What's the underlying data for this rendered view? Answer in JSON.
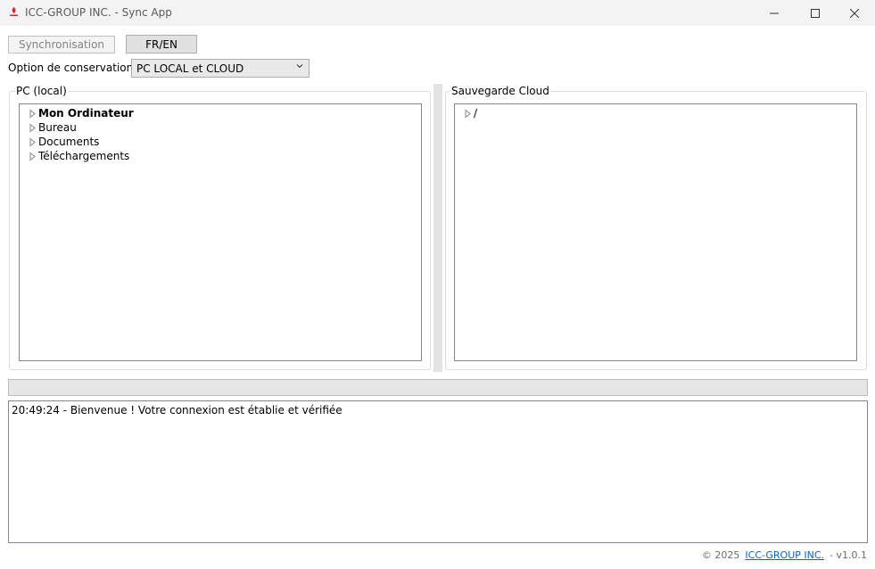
{
  "window": {
    "title": "ICC-GROUP INC. - Sync App",
    "app_icon": "icc-logo-icon",
    "accent_color": "#d9262c"
  },
  "toolbar": {
    "sync_label": "Synchronisation",
    "lang_label": "FR/EN"
  },
  "options": {
    "label": "Option de conservation :",
    "selected": "PC LOCAL et CLOUD"
  },
  "local_panel": {
    "title": "PC (local)",
    "items": [
      {
        "label": "Mon Ordinateur"
      },
      {
        "label": "Bureau"
      },
      {
        "label": "Documents"
      },
      {
        "label": "Téléchargements"
      }
    ]
  },
  "cloud_panel": {
    "title": "Sauvegarde Cloud",
    "items": [
      {
        "label": "/"
      }
    ]
  },
  "progress": {
    "value": 0
  },
  "log": {
    "lines": [
      "20:49:24 - Bienvenue ! Votre connexion est établie et vérifiée"
    ]
  },
  "footer": {
    "copyright": "© 2025",
    "company_link": "ICC-GROUP INC.",
    "version": "- v1.0.1"
  }
}
